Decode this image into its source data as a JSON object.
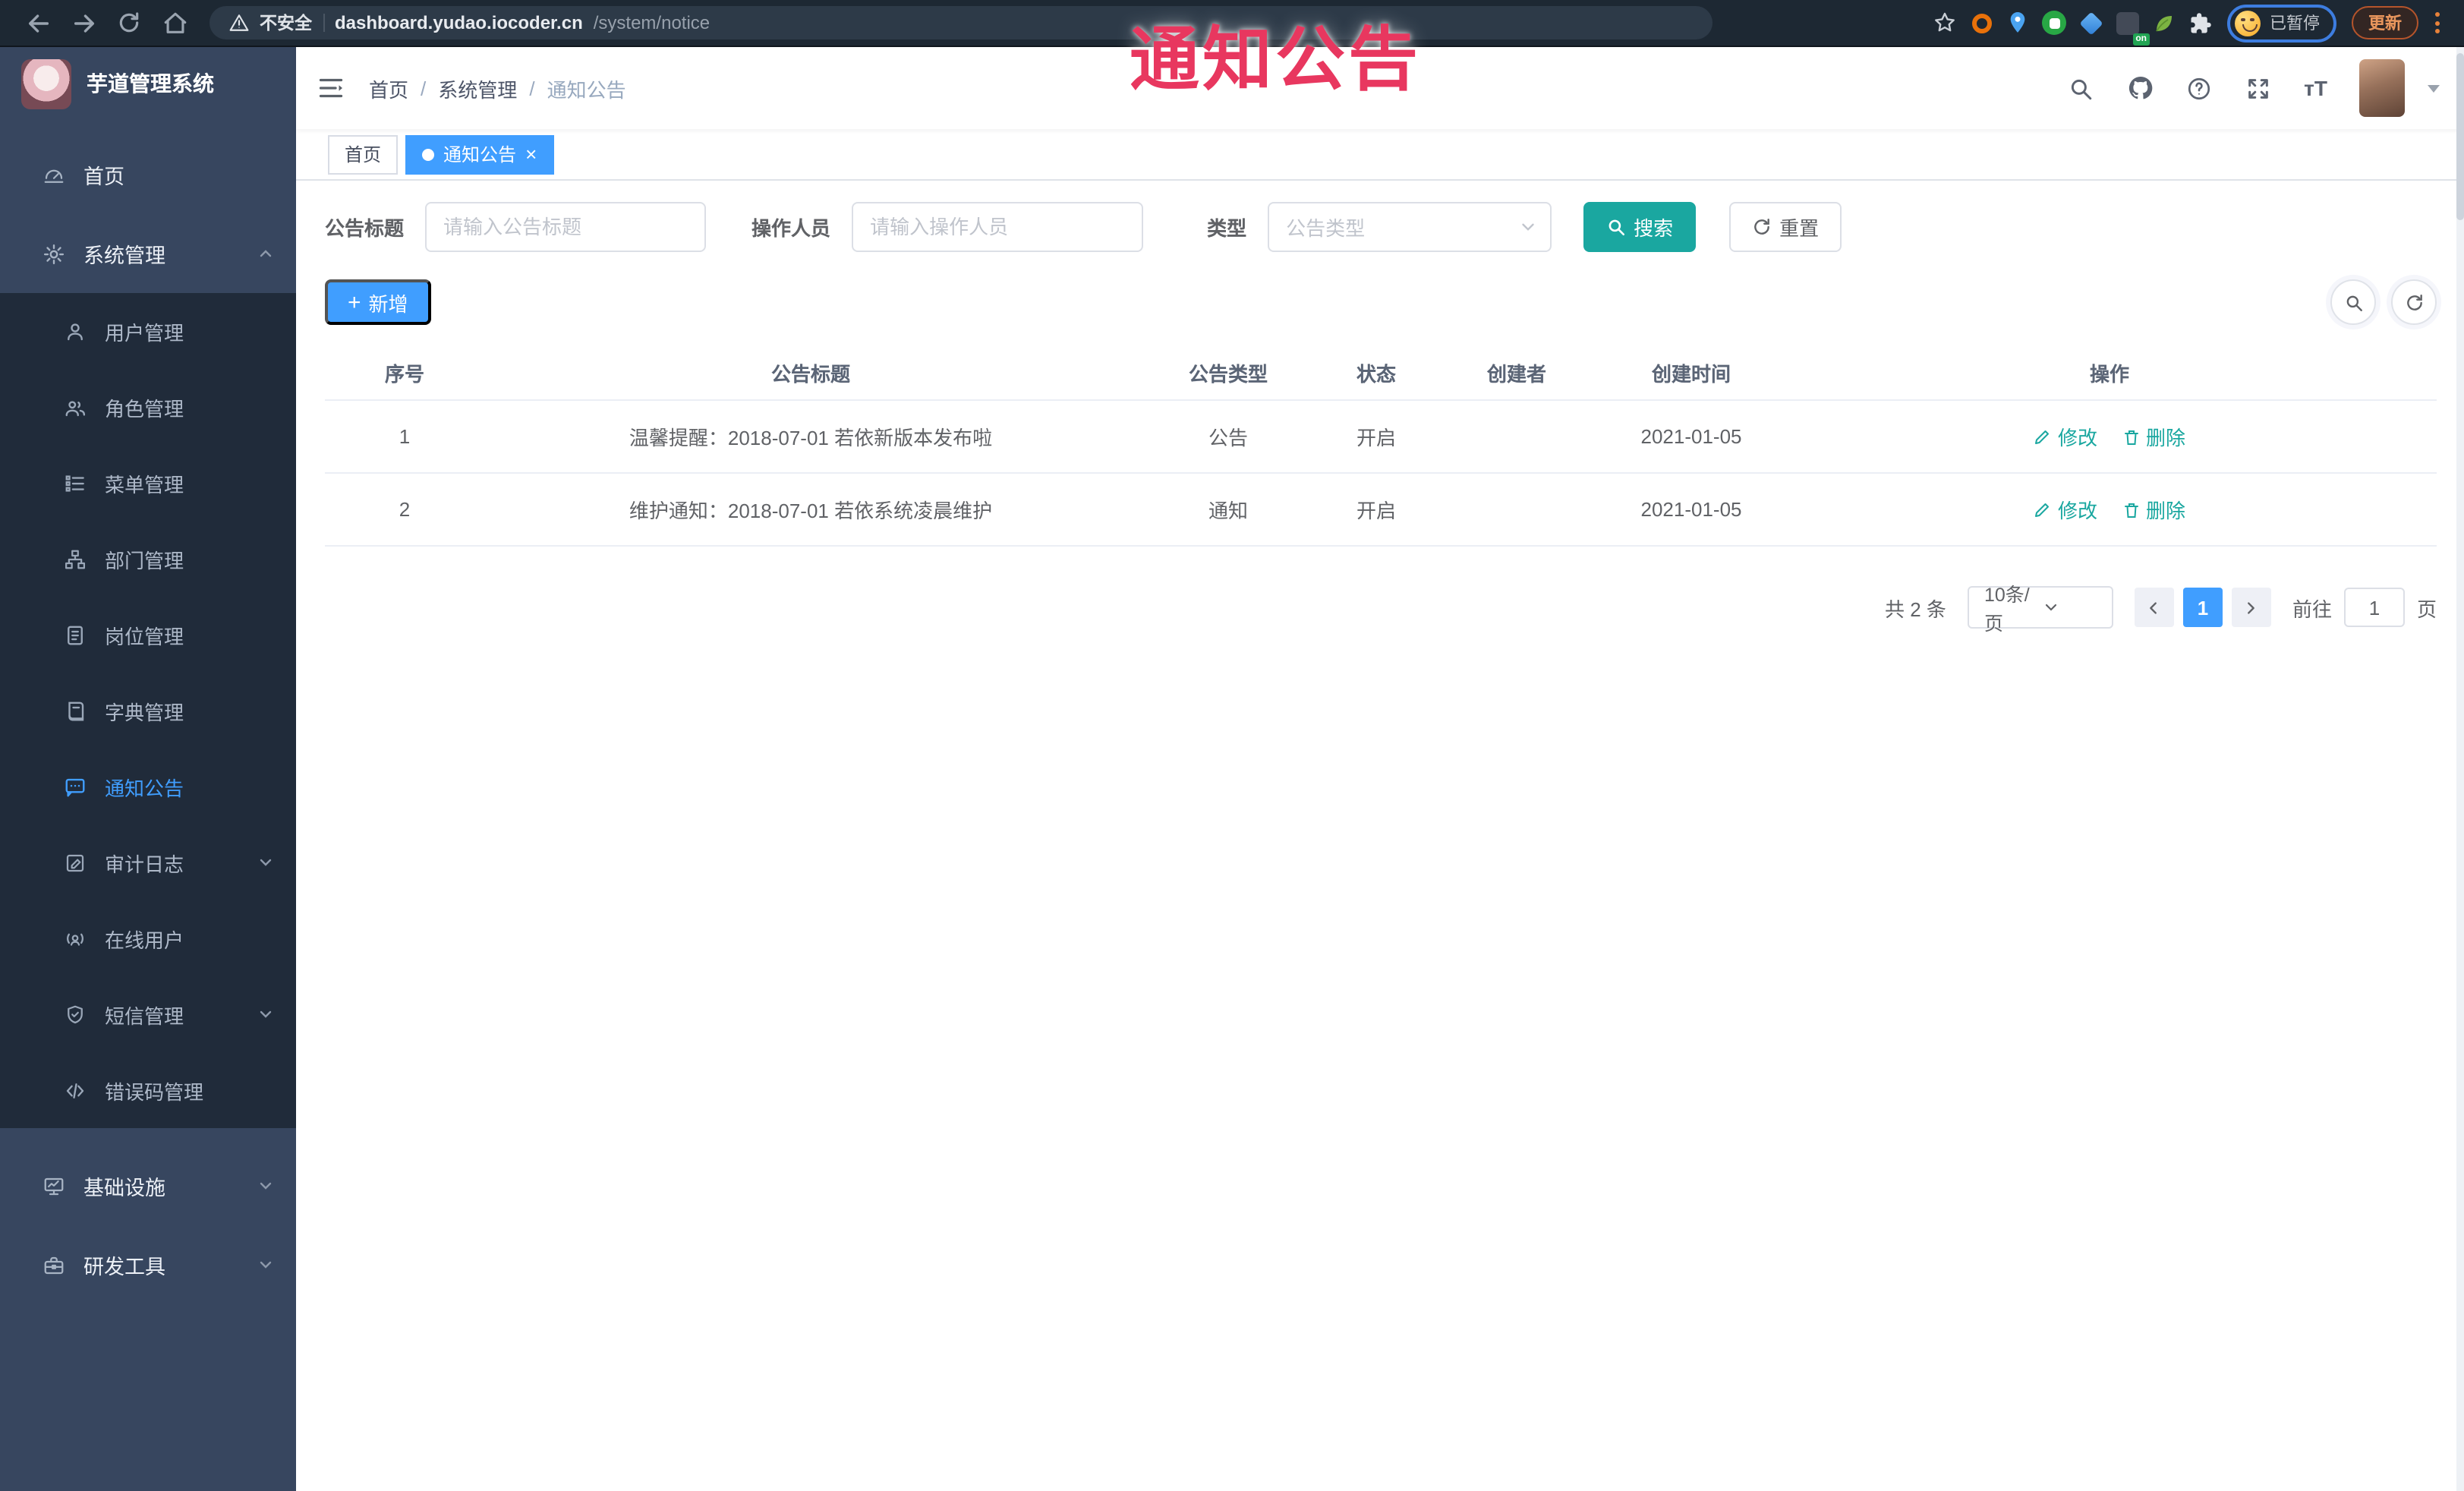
{
  "watermark_text": "通知公告",
  "browser": {
    "security_label": "不安全",
    "url_host": "dashboard.yudao.iocoder.cn",
    "url_path": "/system/notice",
    "extension_badge": "on",
    "paused_label": "已暂停",
    "update_label": "更新"
  },
  "sidebar": {
    "app_title": "芋道管理系统",
    "items": [
      {
        "label": "首页",
        "icon": "home-icon"
      },
      {
        "label": "系统管理",
        "icon": "gear-icon",
        "state": "expanded"
      },
      {
        "label": "用户管理",
        "icon": "user-icon"
      },
      {
        "label": "角色管理",
        "icon": "peoples-icon"
      },
      {
        "label": "菜单管理",
        "icon": "menu-tree-icon"
      },
      {
        "label": "部门管理",
        "icon": "dept-tree-icon"
      },
      {
        "label": "岗位管理",
        "icon": "post-icon"
      },
      {
        "label": "字典管理",
        "icon": "dict-icon"
      },
      {
        "label": "通知公告",
        "icon": "message-icon",
        "state": "active"
      },
      {
        "label": "审计日志",
        "icon": "log-icon",
        "state": "collapsed"
      },
      {
        "label": "在线用户",
        "icon": "online-user-icon"
      },
      {
        "label": "短信管理",
        "icon": "sms-icon",
        "state": "collapsed"
      },
      {
        "label": "错误码管理",
        "icon": "error-code-icon"
      },
      {
        "label": "基础设施",
        "icon": "infrastructure-icon",
        "state": "collapsed"
      },
      {
        "label": "研发工具",
        "icon": "devtools-icon",
        "state": "collapsed"
      }
    ]
  },
  "header": {
    "breadcrumb": [
      "首页",
      "系统管理",
      "通知公告"
    ],
    "breadcrumb_separator": "/",
    "font_size_label": "тT"
  },
  "tags": {
    "items": [
      {
        "label": "首页",
        "active": false
      },
      {
        "label": "通知公告",
        "active": true
      }
    ],
    "close_glyph": "×"
  },
  "filter": {
    "title_label": "公告标题",
    "title_placeholder": "请输入公告标题",
    "operator_label": "操作人员",
    "operator_placeholder": "请输入操作人员",
    "type_label": "类型",
    "type_placeholder": "公告类型",
    "search_label": "搜索",
    "reset_label": "重置"
  },
  "actions": {
    "add_label": "新增",
    "plus_glyph": "+"
  },
  "table": {
    "headers": [
      "序号",
      "公告标题",
      "公告类型",
      "状态",
      "创建者",
      "创建时间",
      "操作"
    ],
    "rows": [
      {
        "no": "1",
        "title": "温馨提醒：2018-07-01 若依新版本发布啦",
        "type": "公告",
        "status": "开启",
        "creator": "",
        "create_time": "2021-01-05"
      },
      {
        "no": "2",
        "title": "维护通知：2018-07-01 若依系统凌晨维护",
        "type": "通知",
        "status": "开启",
        "creator": "",
        "create_time": "2021-01-05"
      }
    ],
    "edit_label": "修改",
    "delete_label": "删除"
  },
  "pagination": {
    "total_text": "共 2 条",
    "page_size_value": "10条/页",
    "current_page": "1",
    "goto_label": "前往",
    "goto_value": "1",
    "page_unit": "页"
  },
  "colors": {
    "primary_blue": "#409EFF",
    "theme_teal": "#1AA7A0",
    "watermark_pink": "#E8375F",
    "sidebar_bg": "#37465F",
    "submenu_bg": "#202B3A"
  }
}
